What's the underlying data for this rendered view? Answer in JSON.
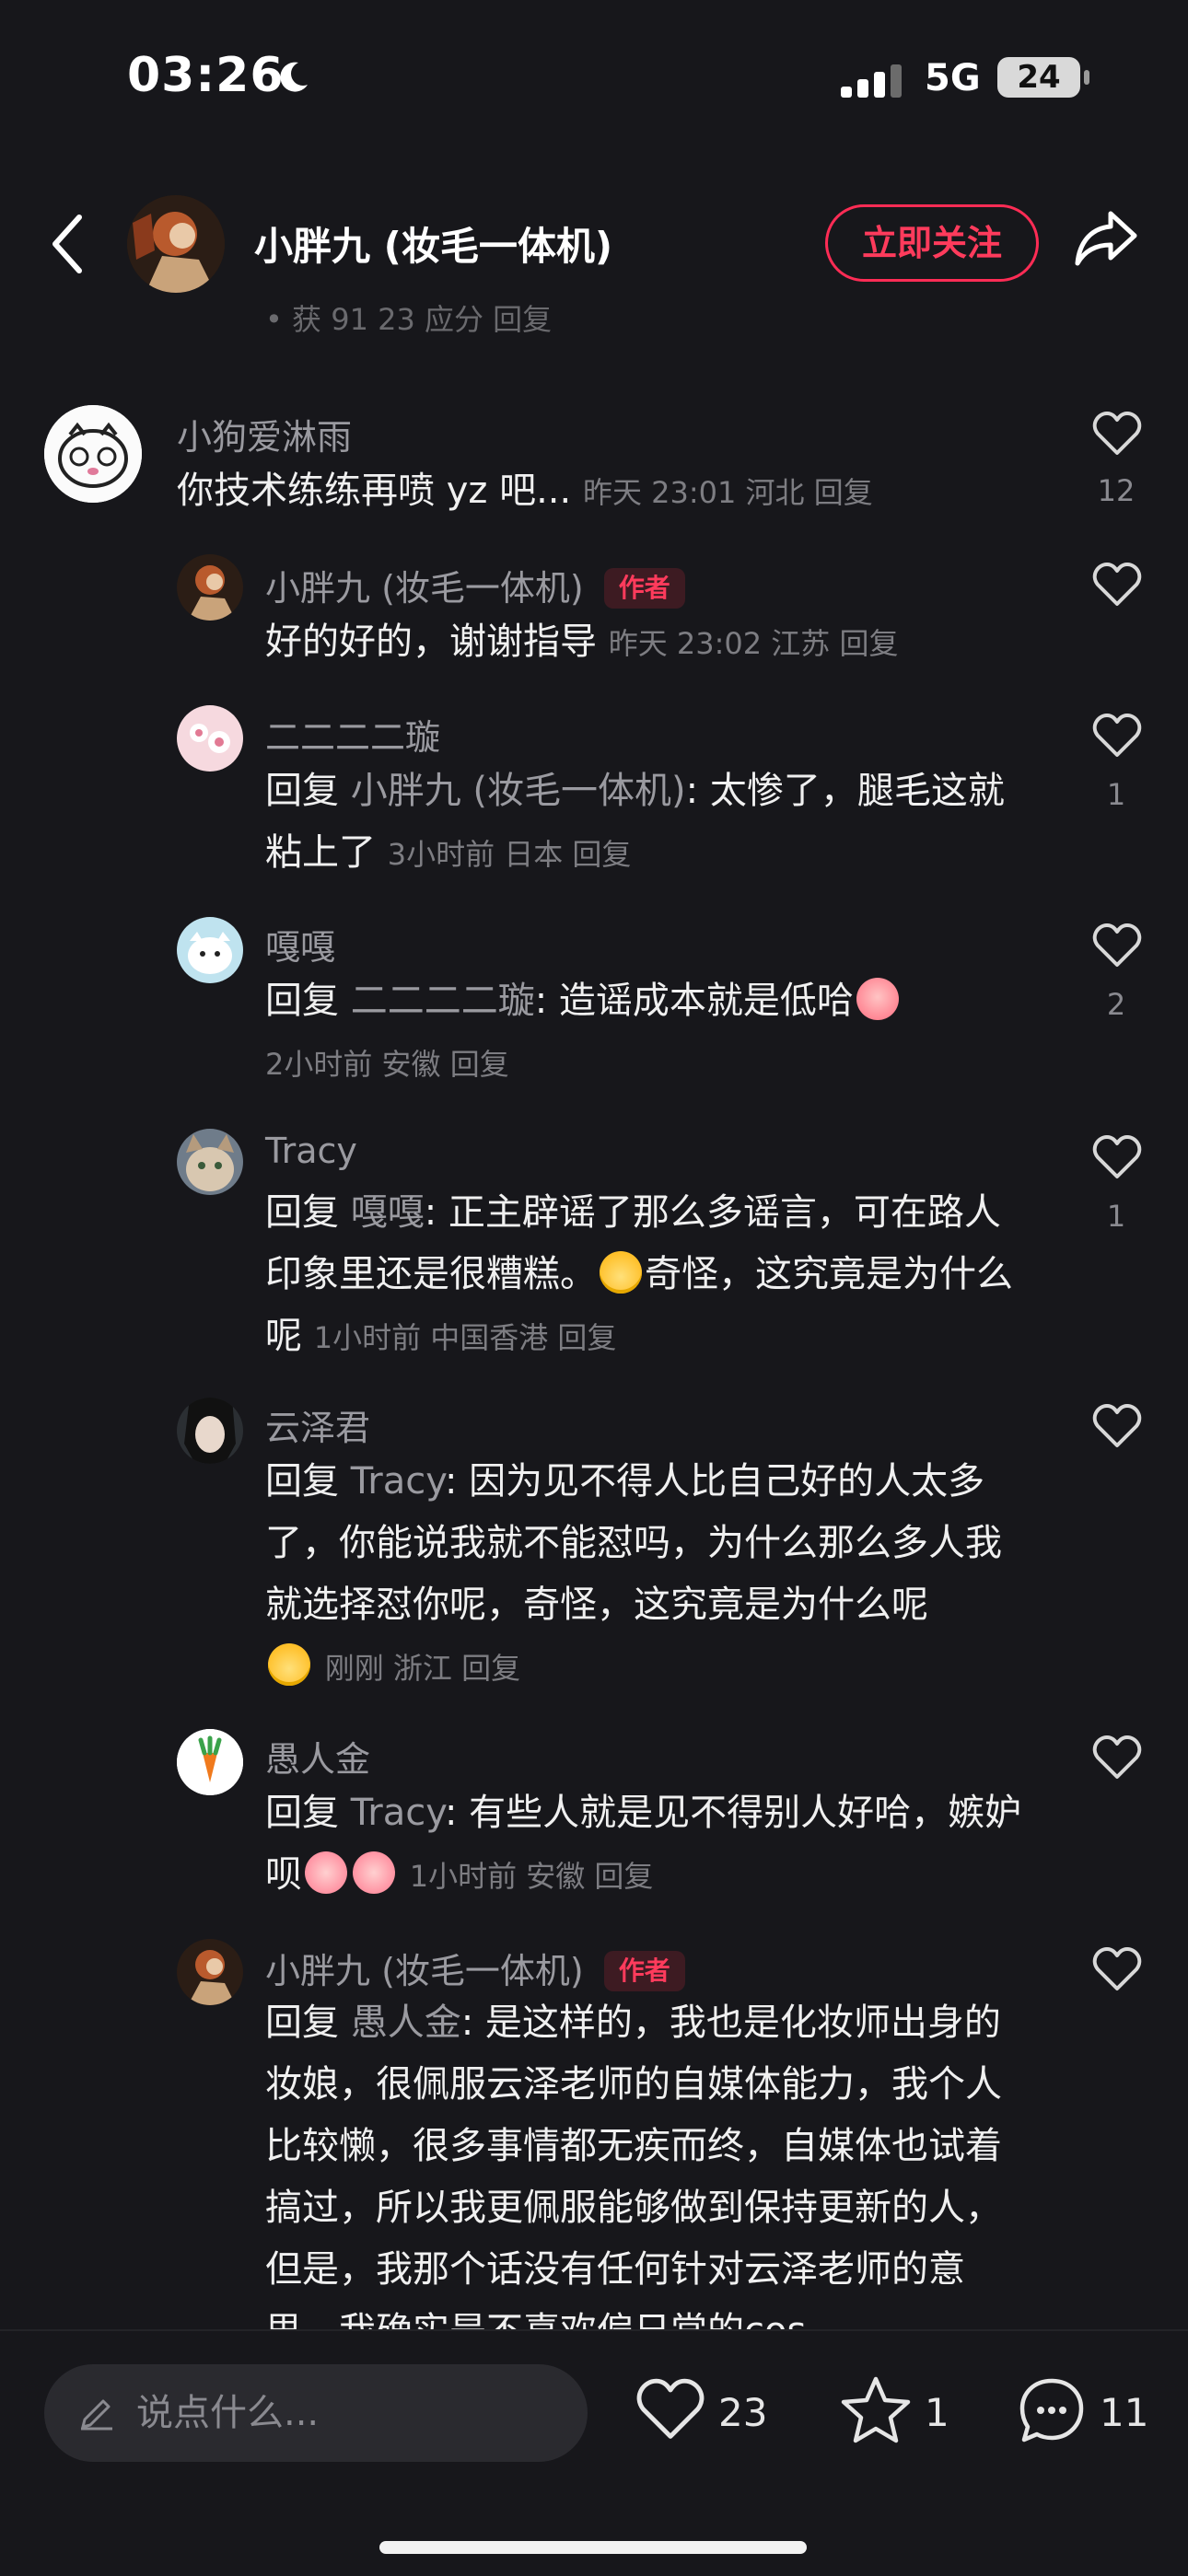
{
  "status_bar": {
    "time": "03:26",
    "network": "5G",
    "battery": "24"
  },
  "header": {
    "author_name": "小胖九 (妆毛一体机)",
    "follow_label": "立即关注",
    "residue_text": "• 获 91 23 应分 回复"
  },
  "comments": [
    {
      "name": "小狗爱淋雨",
      "text": "你技术练练再喷 yz 吧...",
      "meta": "昨天 23:01 河北 回复",
      "likes": "12"
    },
    {
      "name": "小胖九 (妆毛一体机)",
      "tag": "作者",
      "text": "好的好的，谢谢指导",
      "meta": "昨天 23:02 江苏 回复",
      "likes": ""
    },
    {
      "name": "二二二二璇",
      "reply_prefix": "回复 ",
      "reply_to": "小胖九 (妆毛一体机)",
      "text": ": 太惨了，腿毛这就粘上了",
      "meta": "3小时前 日本 回复",
      "likes": "1"
    },
    {
      "name": "嘎嘎",
      "reply_prefix": "回复 ",
      "reply_to": "二二二二璇",
      "text": ": 造谣成本就是低哈",
      "meta": "2小时前 安徽 回复",
      "likes": "2"
    },
    {
      "name": "Tracy",
      "reply_prefix": "回复 ",
      "reply_to": "嘎嘎",
      "text": ": 正主辟谣了那么多谣言，可在路人印象里还是很糟糕。",
      "text2": "奇怪，这究竟是为什么呢",
      "meta": "1小时前 中国香港 回复",
      "likes": "1"
    },
    {
      "name": "云泽君",
      "reply_prefix": "回复 ",
      "reply_to": "Tracy",
      "text": ": 因为见不得人比自己好的人太多了，你能说我就不能怼吗，为什么那么多人我就选择怼你呢，奇怪，这究竟是为什么呢",
      "meta": "刚刚 浙江 回复",
      "likes": ""
    },
    {
      "name": "愚人金",
      "reply_prefix": "回复 ",
      "reply_to": "Tracy",
      "text": ": 有些人就是见不得别人好哈，嫉妒呗",
      "meta": "1小时前 安徽 回复",
      "likes": ""
    },
    {
      "name": "小胖九 (妆毛一体机)",
      "tag": "作者",
      "reply_prefix": "回复 ",
      "reply_to": "愚人金",
      "text": ": 是这样的，我也是化妆师出身的妆娘，很佩服云泽老师的自媒体能力，我个人比较懒，很多事情都无疾而终，自媒体也试着搞过，所以我更佩服能够做到保持更新的人，但是，我那个话没有任何针对云泽老师的意思，我确实是不喜欢偏日常的cos",
      "meta": "",
      "likes": ""
    }
  ],
  "bottom_bar": {
    "input_placeholder": "说点什么...",
    "likes": "23",
    "stars": "1",
    "comments": "11"
  },
  "icons": [
    "moon-icon",
    "signal-icon",
    "battery-icon",
    "back-icon",
    "share-icon",
    "heart-icon",
    "pencil-icon",
    "star-icon",
    "comment-icon"
  ]
}
